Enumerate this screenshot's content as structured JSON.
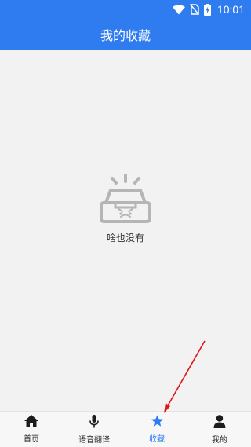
{
  "status_bar": {
    "time": "10:01",
    "icons": [
      "wifi-icon",
      "no-sim-icon",
      "battery-charging-icon"
    ]
  },
  "app_bar": {
    "title": "我的收藏"
  },
  "empty_state": {
    "icon": "empty-box-icon",
    "label": "啥也没有"
  },
  "tabbar": {
    "tabs": [
      {
        "label": "首页",
        "icon": "home-icon",
        "active": false
      },
      {
        "label": "语音翻译",
        "icon": "microphone-icon",
        "active": false
      },
      {
        "label": "收藏",
        "icon": "star-icon",
        "active": true
      },
      {
        "label": "我的",
        "icon": "person-icon",
        "active": false
      }
    ]
  },
  "annotation": {
    "color": "#e0151a",
    "points_to": "收藏"
  },
  "colors": {
    "accent": "#2f7cf0",
    "background": "#f2f2f2",
    "tab_inactive": "#222222"
  }
}
